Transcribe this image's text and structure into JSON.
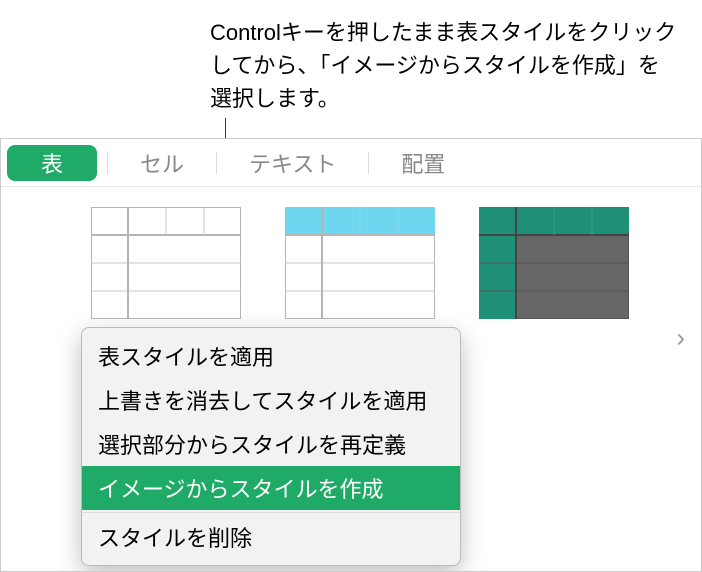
{
  "callout": {
    "text": "Controlキーを押したまま表スタイルをクリックしてから、「イメージからスタイルを作成」を選択します。"
  },
  "tabs": {
    "items": [
      {
        "label": "表",
        "active": true
      },
      {
        "label": "セル",
        "active": false
      },
      {
        "label": "テキスト",
        "active": false
      },
      {
        "label": "配置",
        "active": false
      }
    ]
  },
  "styles": {
    "thumb1": {
      "name": "table-style-plain"
    },
    "thumb2": {
      "name": "table-style-cyan-header"
    },
    "thumb3": {
      "name": "table-style-teal-dark"
    },
    "thumb4": {
      "name": "table-style-gray-header"
    }
  },
  "contextMenu": {
    "items": [
      {
        "label": "表スタイルを適用",
        "highlight": false
      },
      {
        "label": "上書きを消去してスタイルを適用",
        "highlight": false
      },
      {
        "label": "選択部分からスタイルを再定義",
        "highlight": false
      },
      {
        "label": "イメージからスタイルを作成",
        "highlight": true
      },
      {
        "label": "スタイルを削除",
        "highlight": false
      }
    ]
  },
  "nav": {
    "nextGlyph": "›"
  }
}
